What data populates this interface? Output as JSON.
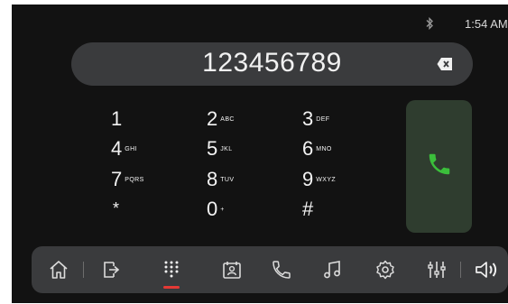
{
  "status": {
    "time": "1:54 AM"
  },
  "dialer": {
    "number": "123456789",
    "keys": [
      {
        "digit": "1",
        "letters": ""
      },
      {
        "digit": "2",
        "letters": "ABC"
      },
      {
        "digit": "3",
        "letters": "DEF"
      },
      {
        "digit": "4",
        "letters": "GHI"
      },
      {
        "digit": "5",
        "letters": "JKL"
      },
      {
        "digit": "6",
        "letters": "MNO"
      },
      {
        "digit": "7",
        "letters": "PQRS"
      },
      {
        "digit": "8",
        "letters": "TUV"
      },
      {
        "digit": "9",
        "letters": "WXYZ"
      },
      {
        "digit": "*",
        "letters": ""
      },
      {
        "digit": "0",
        "letters": "+"
      },
      {
        "digit": "#",
        "letters": ""
      }
    ]
  },
  "colors": {
    "call_green": "#3bbf3b",
    "active_red": "#e53935"
  },
  "icons": [
    "bluetooth-icon",
    "backspace-icon",
    "phone-call-icon",
    "home-icon",
    "exit-app-icon",
    "dialpad-icon",
    "contacts-icon",
    "phone-icon",
    "music-icon",
    "settings-icon",
    "equalizer-icon",
    "volume-icon"
  ]
}
